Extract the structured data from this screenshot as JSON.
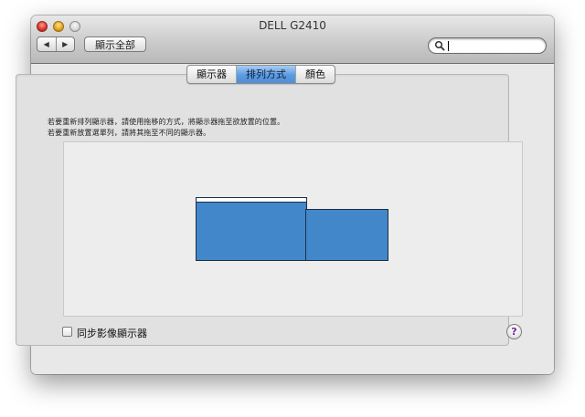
{
  "window": {
    "title": "DELL G2410",
    "nav_back_icon": "◀",
    "nav_forward_icon": "▶",
    "show_all_label": "顯示全部"
  },
  "search": {
    "placeholder": "",
    "value": ""
  },
  "tabs": [
    {
      "label": "顯示器",
      "selected": false
    },
    {
      "label": "排列方式",
      "selected": true
    },
    {
      "label": "顏色",
      "selected": false
    }
  ],
  "instructions": {
    "line1": "若要重新排列顯示器，請使用拖移的方式，將顯示器拖至欲放置的位置。",
    "line2": "若要重新放置選單列，請將其拖至不同的顯示器。"
  },
  "arrangement": {
    "displays": [
      {
        "name": "primary-display",
        "has_menubar": true,
        "color": "#4287c9"
      },
      {
        "name": "secondary-display",
        "has_menubar": false,
        "color": "#4287c9"
      }
    ]
  },
  "mirror": {
    "label": "同步影像顯示器",
    "checked": false
  },
  "help_label": "?",
  "colors": {
    "accent": "#5c9be1",
    "display_fill": "#4287c9"
  }
}
